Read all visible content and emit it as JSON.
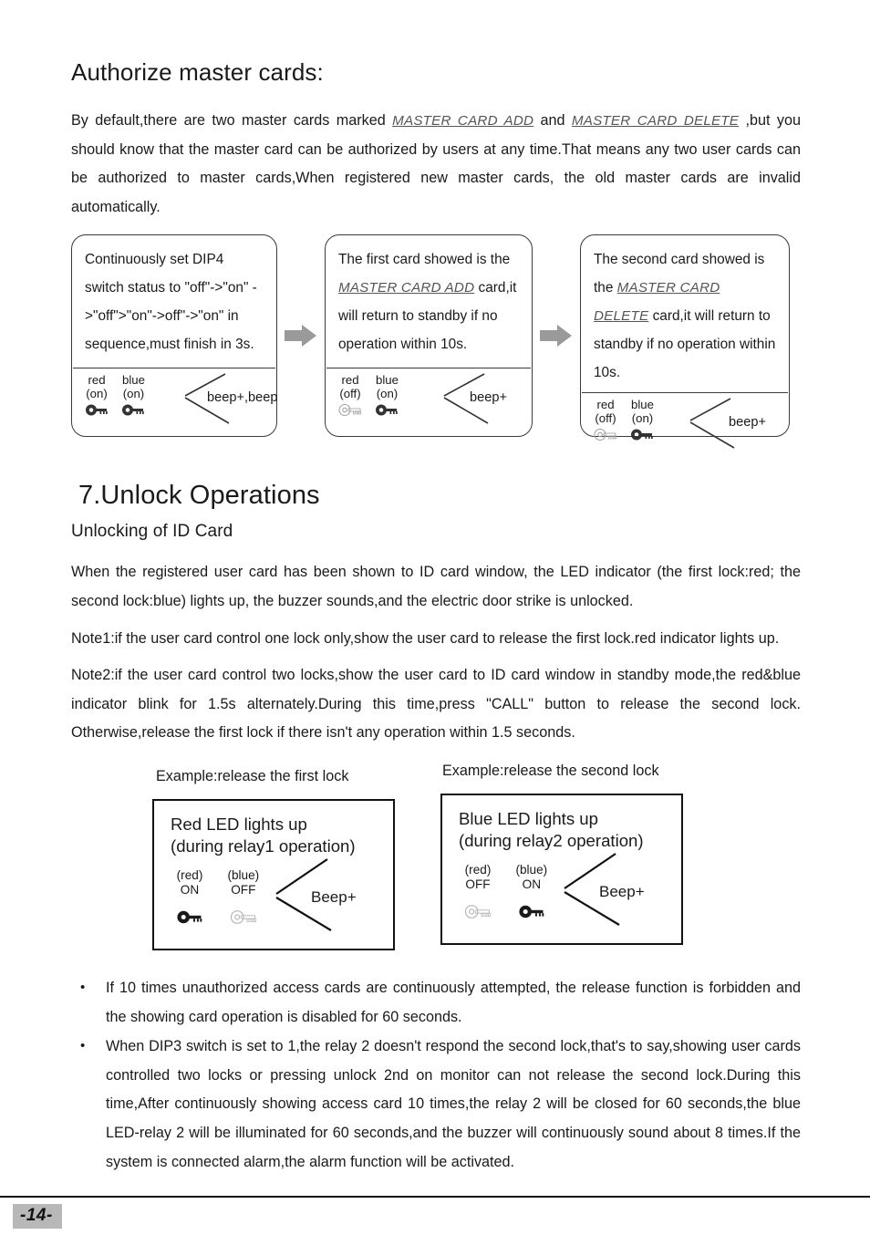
{
  "section_heading": "Authorize master cards:",
  "intro": {
    "part1": "By default,there are two master cards marked ",
    "link1": "MASTER CARD ADD",
    "part2": " and ",
    "link2": "MASTER CARD DELETE",
    "part3": " ,but you should know that the master card can be authorized by users at any time.That means any two user cards can be authorized to master cards,When registered new master cards, the old master cards are invalid automatically."
  },
  "flow": {
    "arrow_icon": "right-arrow-icon",
    "boxes": [
      {
        "text": "Continuously set DIP4 switch status to \"off\"->\"on\" ->\"off\">\"on\"->off\"->\"on\" in sequence,must finish in 3s.",
        "leds": [
          {
            "color": "red",
            "state": "(on)",
            "key_icon": "key-icon-on"
          },
          {
            "color": "blue",
            "state": "(on)",
            "key_icon": "key-icon-on"
          }
        ],
        "beep": "beep+,beep"
      },
      {
        "text_pre": "The first card showed is the ",
        "text_link": "MASTER CARD ADD",
        "text_post": " card,it will return to standby if no operation within 10s.",
        "leds": [
          {
            "color": "red",
            "state": "(off)",
            "key_icon": "key-icon-off"
          },
          {
            "color": "blue",
            "state": "(on)",
            "key_icon": "key-icon-on"
          }
        ],
        "beep": "beep+"
      },
      {
        "text_pre": "The second card showed is the ",
        "text_link": "MASTER CARD DELETE",
        "text_post": " card,it will return to standby if no operation within 10s.",
        "leds": [
          {
            "color": "red",
            "state": "(off)",
            "key_icon": "key-icon-off"
          },
          {
            "color": "blue",
            "state": "(on)",
            "key_icon": "key-icon-on"
          }
        ],
        "beep": "beep+"
      }
    ]
  },
  "chapter": {
    "title": "7.Unlock Operations",
    "subtitle": "Unlocking of ID Card",
    "paragraphs": [
      "When the registered user card has been shown to ID card window, the LED indicator (the first lock:red; the second lock:blue) lights up, the buzzer sounds,and the electric door strike is unlocked.",
      "Note1:if the user card control one lock only,show the user card to release the first lock.red indicator lights up.",
      "Note2:if the user card control two locks,show the user card to ID card window in standby mode,the red&blue indicator blink for 1.5s alternately.During this time,press \"CALL\" button to release the second lock. Otherwise,release the first lock if there isn't any operation within 1.5 seconds."
    ]
  },
  "examples": [
    {
      "label": "Example:release the first lock",
      "title_line1": "Red LED lights up",
      "title_line2": "(during relay1 operation)",
      "leds": [
        {
          "color": "(red)",
          "state": "ON",
          "key_icon": "key-icon-on"
        },
        {
          "color": "(blue)",
          "state": "OFF",
          "key_icon": "key-icon-off"
        }
      ],
      "beep": "Beep+"
    },
    {
      "label": "Example:release the second lock",
      "title_line1": "Blue LED lights up",
      "title_line2": "(during relay2 operation)",
      "leds": [
        {
          "color": "(red)",
          "state": "OFF",
          "key_icon": "key-icon-off"
        },
        {
          "color": "(blue)",
          "state": "ON",
          "key_icon": "key-icon-on"
        }
      ],
      "beep": "Beep+"
    }
  ],
  "bullets": [
    "If 10 times unauthorized access cards are continuously attempted, the release function is forbidden and the showing card operation is disabled for 60 seconds.",
    "When DIP3 switch is set to 1,the relay 2 doesn't respond the second lock,that's to say,showing user cards controlled two locks or pressing unlock 2nd on monitor can not release the second lock.During this time,After continuously showing access card 10 times,the relay 2 will be closed for 60 seconds,the blue LED-relay 2 will be illuminated for 60 seconds,and the buzzer will continuously sound about 8 times.If the system is connected alarm,the alarm function will be activated."
  ],
  "bullet_marker": "•",
  "footer": {
    "page_number": "-14-"
  },
  "colors": {
    "text": "#1a1a1a",
    "box_border": "#3a3a3a",
    "example_border": "#111111",
    "arrow_fill": "#9a9a9a",
    "page_badge_bg": "#b8b8b8",
    "link_gray": "#555555"
  }
}
